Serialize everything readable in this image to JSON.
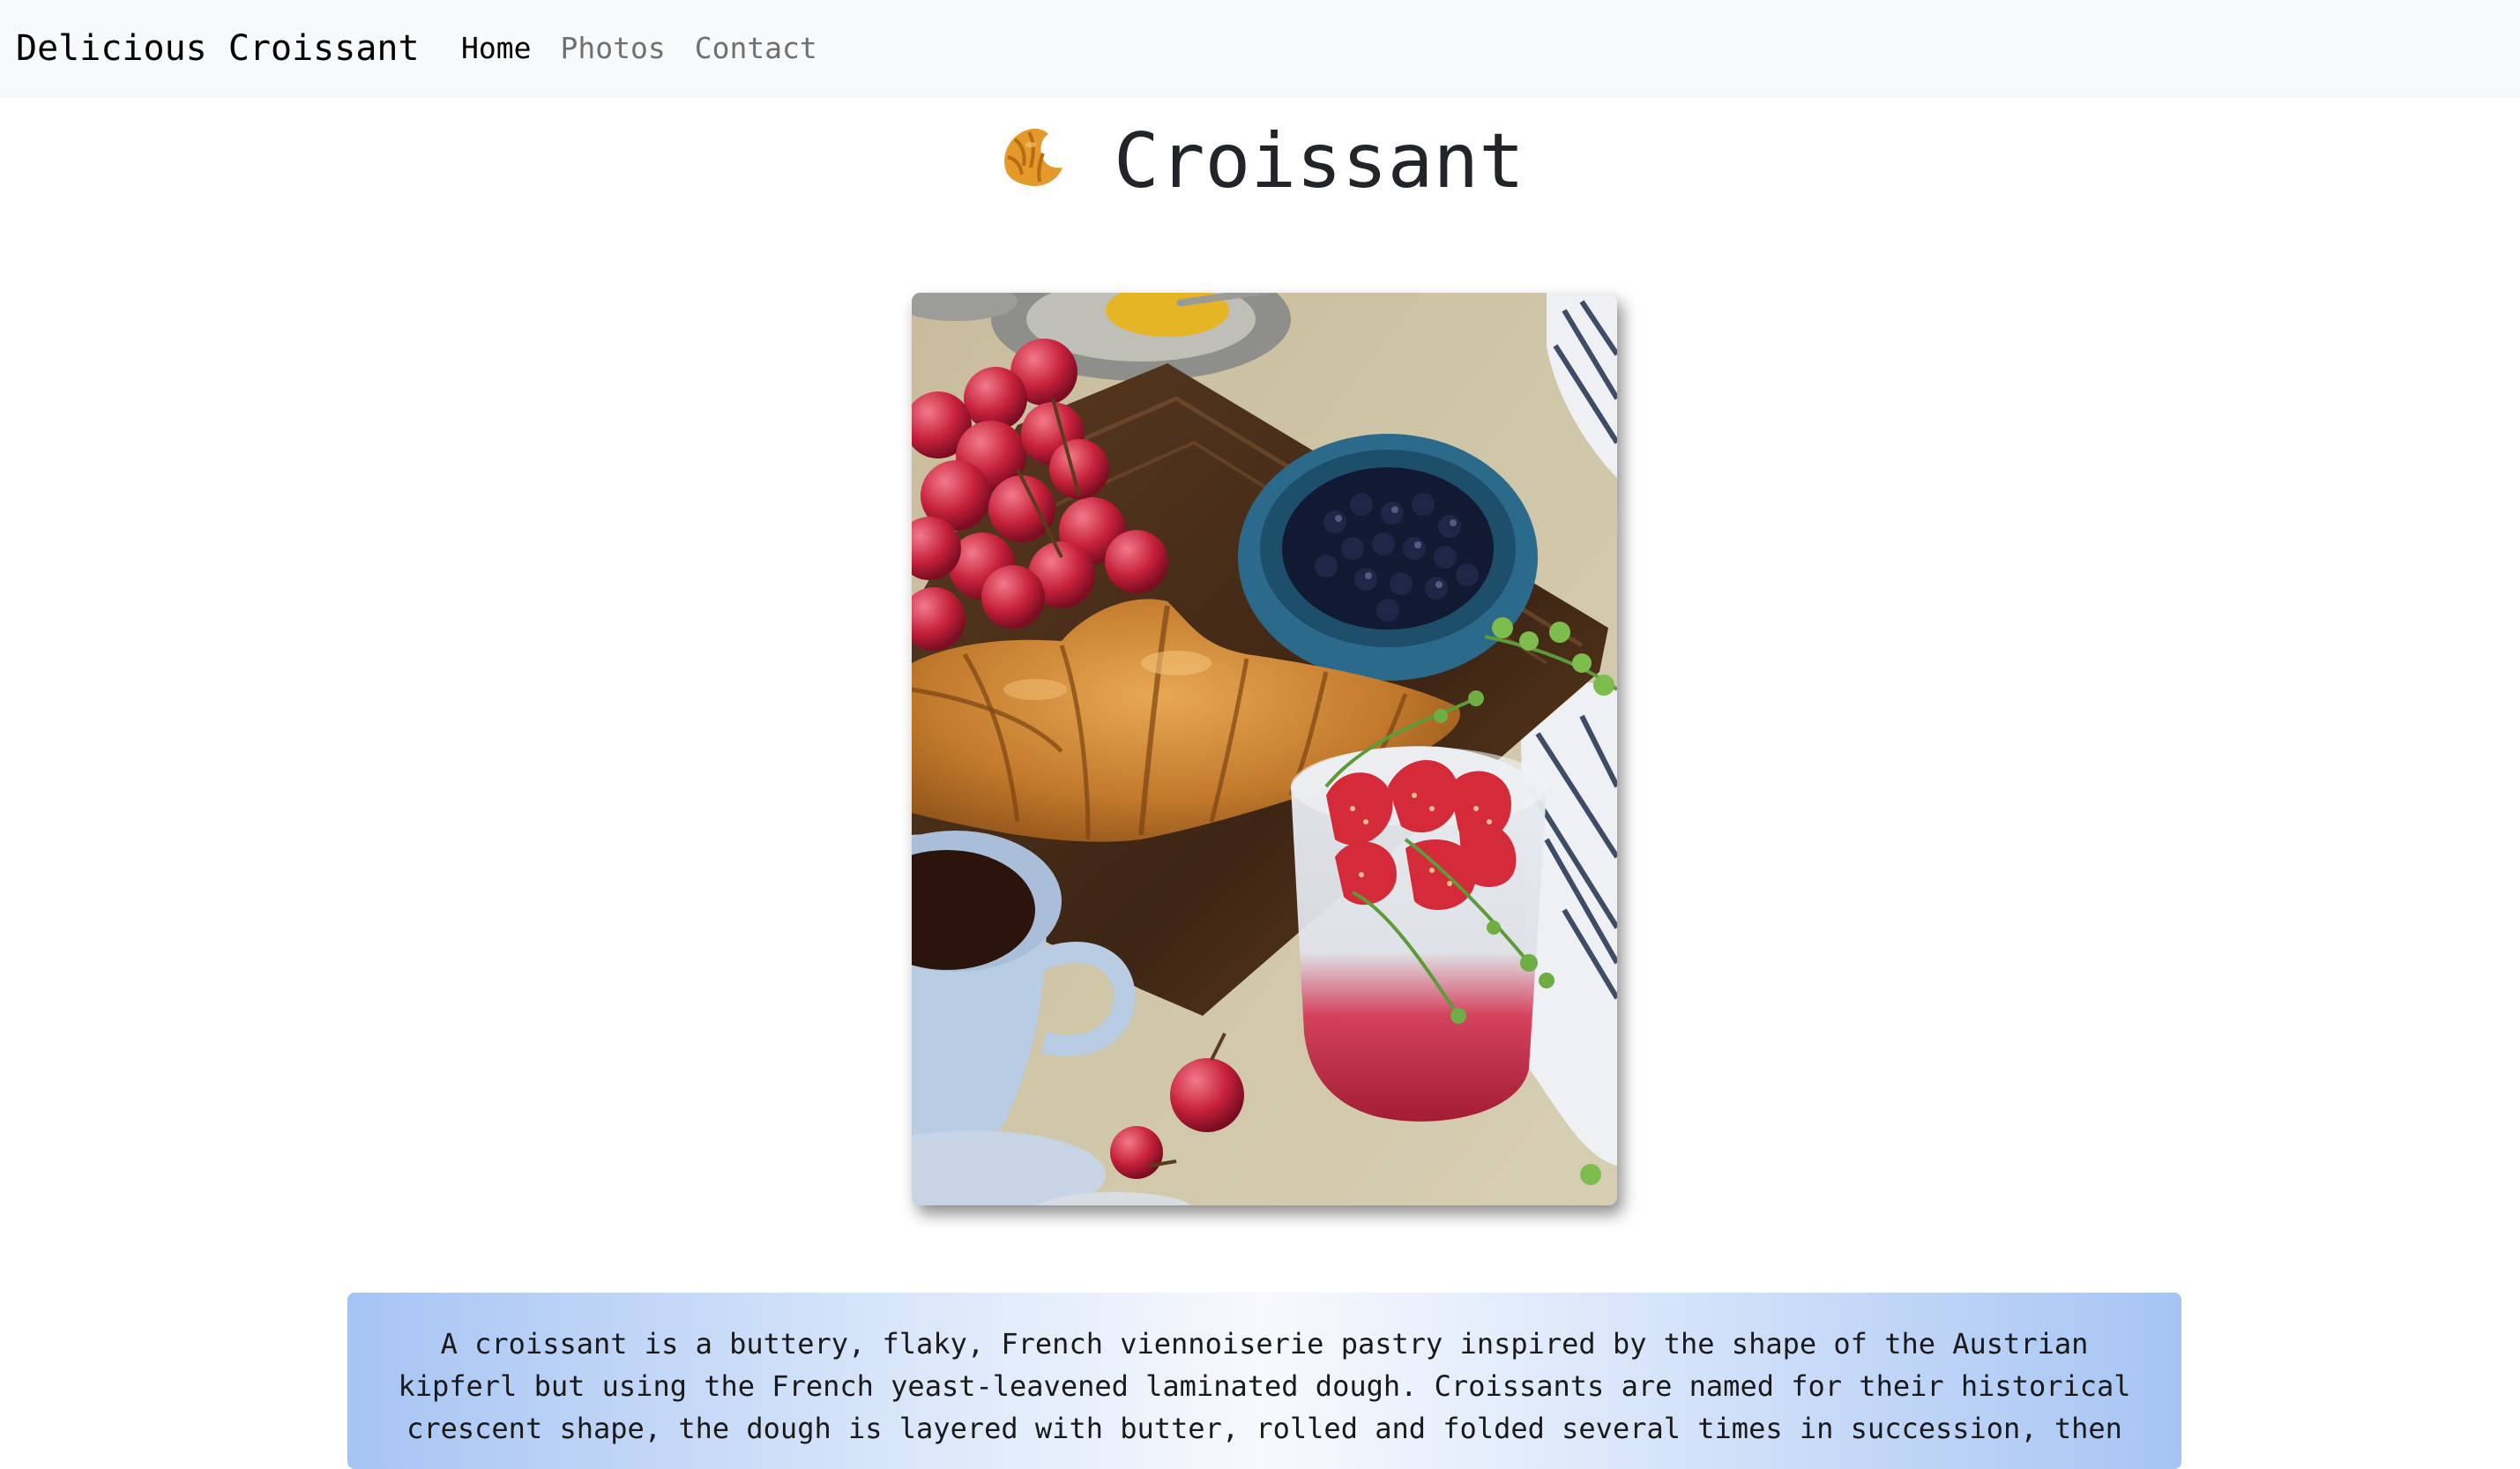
{
  "navbar": {
    "brand": "Delicious Croissant",
    "links": [
      {
        "label": "Home",
        "active": true
      },
      {
        "label": "Photos",
        "active": false
      },
      {
        "label": "Contact",
        "active": false
      }
    ]
  },
  "main": {
    "title_emoji": "croissant-emoji",
    "title": "Croissant",
    "photo_alt": "croissant breakfast spread with grapes, blueberries, coffee and strawberry chia pudding",
    "description": "A croissant is a buttery, flaky, French viennoiserie pastry inspired by the shape of the Austrian kipferl but using the French yeast-leavened laminated dough. Croissants are named for their historical crescent shape, the dough is layered with butter, rolled and folded several times in succession, then"
  },
  "colors": {
    "navbar_bg": "#f8f9fa",
    "nav_active": "#000000",
    "nav_inactive": "#707070",
    "description_gradient_edge": "#a6c4f3"
  }
}
